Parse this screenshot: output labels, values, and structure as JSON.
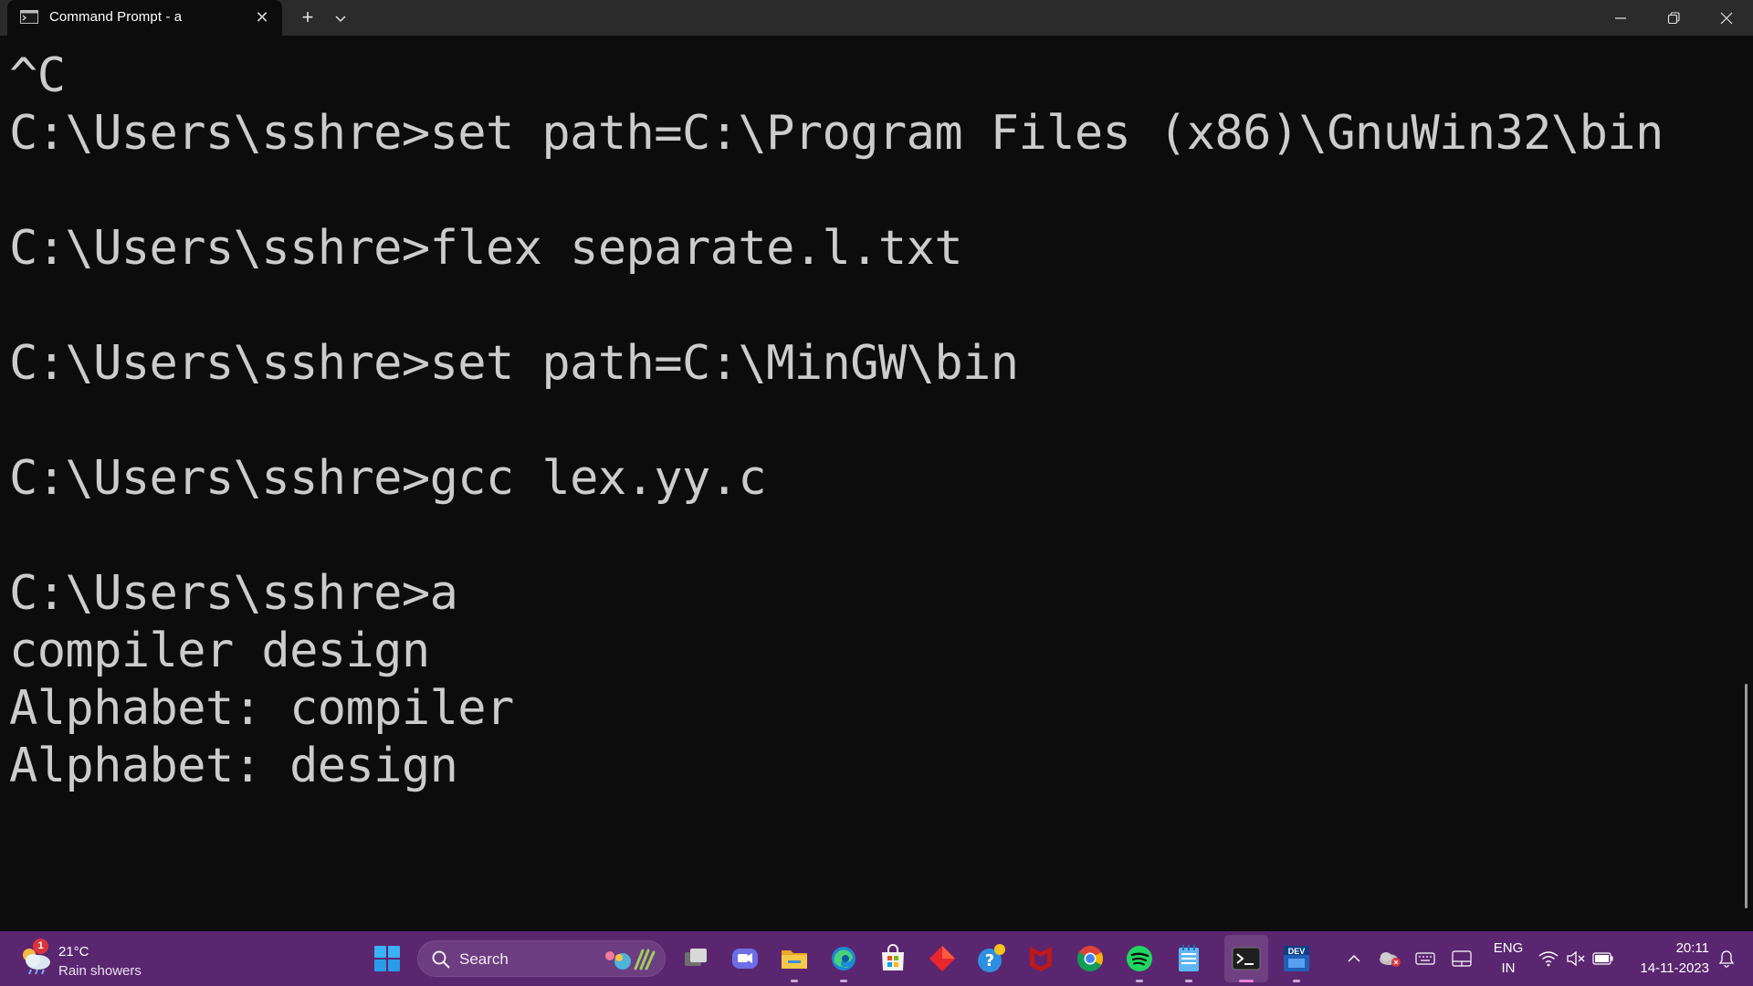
{
  "window": {
    "tab_title": "Command Prompt - a",
    "tab_close_glyph": "✕",
    "new_tab_glyph": "+",
    "controls": [
      "minimize-icon",
      "restore-icon",
      "close-icon"
    ]
  },
  "terminal": {
    "text_color": "#cccccc",
    "background": "#0c0c0c",
    "lines": [
      "^C",
      "C:\\Users\\sshre>set path=C:\\Program Files (x86)\\GnuWin32\\bin",
      "",
      "C:\\Users\\sshre>flex separate.l.txt",
      "",
      "C:\\Users\\sshre>set path=C:\\MinGW\\bin",
      "",
      "C:\\Users\\sshre>gcc lex.yy.c",
      "",
      "C:\\Users\\sshre>a",
      "compiler design",
      "Alphabet: compiler",
      "Alphabet: design"
    ]
  },
  "taskbar": {
    "background": "#5b2670",
    "weather": {
      "badge": "1",
      "temperature": "21°C",
      "condition": "Rain showers"
    },
    "search_label": "Search",
    "apps": [
      "windows-start-icon",
      "task-view-icon",
      "teams-chat-icon",
      "file-explorer-icon",
      "edge-icon",
      "microsoft-store-icon",
      "red-diamond-app-icon",
      "help-icon",
      "mcafee-icon",
      "chrome-icon",
      "spotify-icon",
      "notepad-icon",
      "terminal-icon",
      "dev-cpp-icon"
    ],
    "tray": {
      "language_line1": "ENG",
      "language_line2": "IN",
      "time": "20:11",
      "date": "14-11-2023",
      "dev_label": "DEV"
    }
  }
}
